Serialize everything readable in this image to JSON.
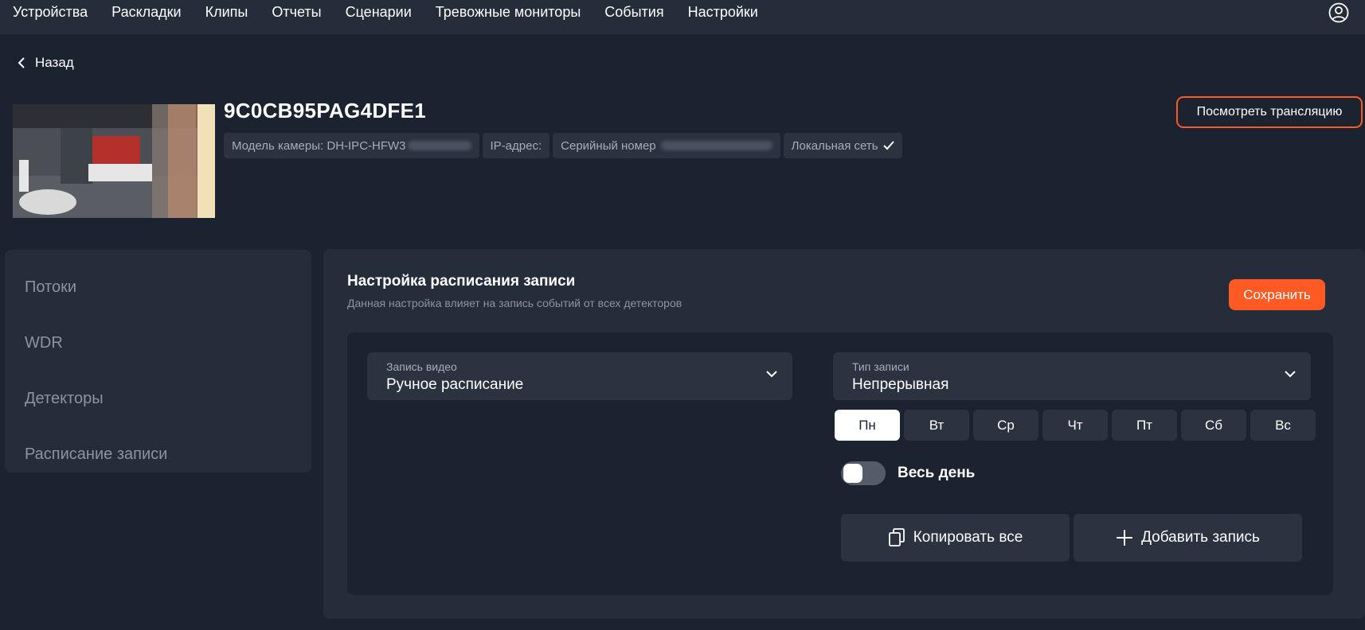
{
  "nav": {
    "items": [
      "Устройства",
      "Раскладки",
      "Клипы",
      "Отчеты",
      "Сценарии",
      "Тревожные мониторы",
      "События",
      "Настройки"
    ],
    "user_icon": "user-circle-icon"
  },
  "back_label": "Назад",
  "camera": {
    "title": "9C0CB95PAG4DFE1",
    "model_label": "Модель камеры: DH-IPC-HFW3",
    "ip_label": "IP-адрес:",
    "serial_label": "Серийный номер",
    "network_label": "Локальная сеть",
    "watch_button": "Посмотреть трансляцию"
  },
  "sidebar": {
    "items": [
      "Потоки",
      "WDR",
      "Детекторы",
      "Расписание записи"
    ]
  },
  "schedule": {
    "title": "Настройка расписания записи",
    "subtitle": "Данная настройка влияет на запись событий от всех детекторов",
    "save_button": "Сохранить",
    "video_record": {
      "label": "Запись видео",
      "value": "Ручное расписание"
    },
    "record_type": {
      "label": "Тип записи",
      "value": "Непрерывная"
    },
    "days": [
      "Пн",
      "Вт",
      "Ср",
      "Чт",
      "Пт",
      "Сб",
      "Вс"
    ],
    "active_day": "Пн",
    "all_day_label": "Весь день",
    "all_day_on": false,
    "copy_all_button": "Копировать все",
    "add_record_button": "Добавить запись"
  },
  "colors": {
    "accent": "#ff5a24",
    "background": "#1c2330",
    "panel": "#252c3a"
  }
}
